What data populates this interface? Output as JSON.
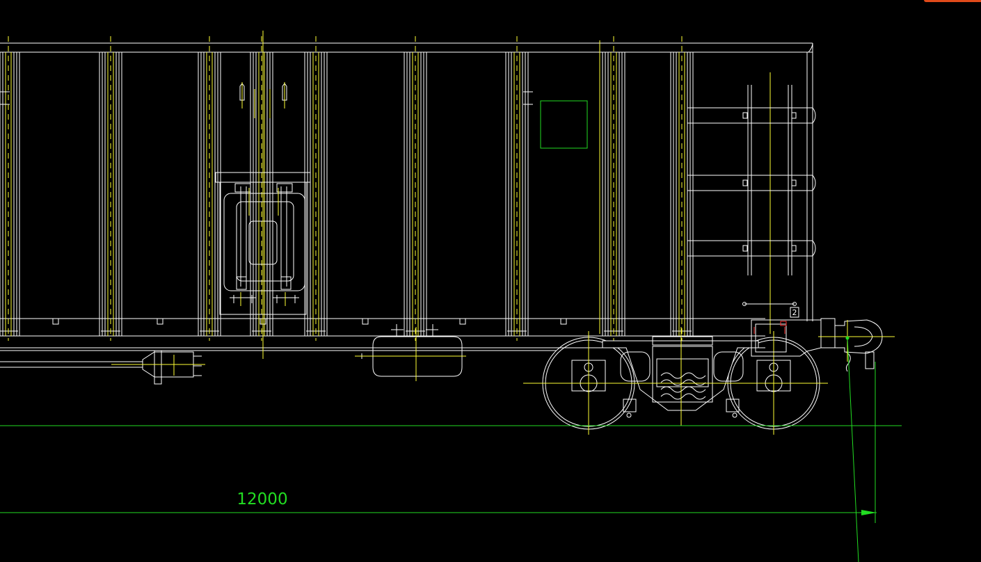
{
  "drawing": {
    "dimension_text": "12000",
    "bogie_mark_text": "2",
    "colors": {
      "background": "#000000",
      "geometry": "#ffffff",
      "centerlines": "#ffff33",
      "dimension": "#22dd22",
      "highlight": "#ff3333",
      "corner_accent": "#e04a1a"
    }
  }
}
